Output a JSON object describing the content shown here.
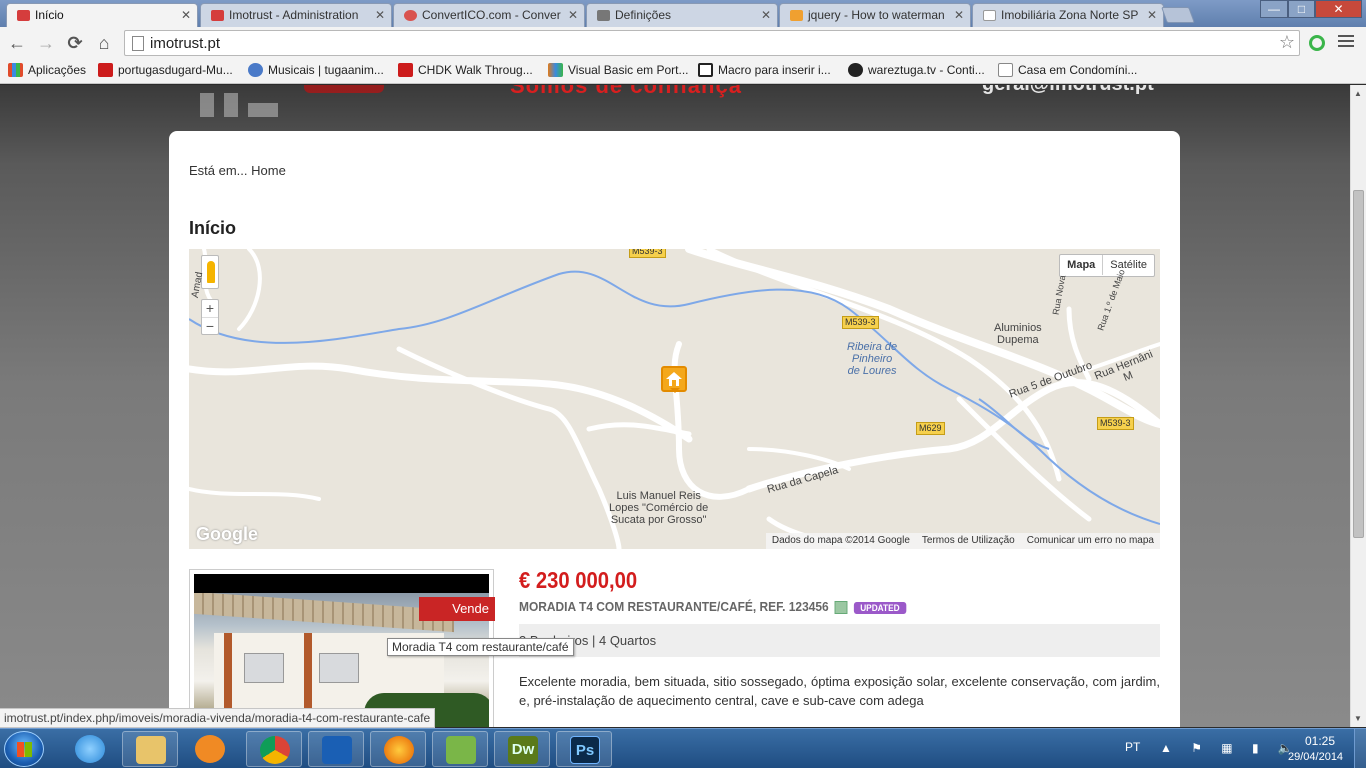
{
  "tabs": [
    {
      "label": "Início",
      "favicon_color": "#d53d3d",
      "active": true
    },
    {
      "label": "Imotrust - Administration",
      "favicon_color": "#d53d3d",
      "active": false
    },
    {
      "label": "ConvertICO.com - Conver",
      "favicon_color": "#d9534f",
      "active": false
    },
    {
      "label": "Definições",
      "favicon_color": "#777777",
      "active": false
    },
    {
      "label": "jquery - How to waterman",
      "favicon_color": "#f0a030",
      "active": false
    },
    {
      "label": "Imobiliária Zona Norte SP",
      "favicon_color": "#ffffff",
      "active": false
    }
  ],
  "window_controls": {
    "minimize": "—",
    "maximize": "□",
    "close": "✕"
  },
  "nav": {
    "back": "←",
    "forward": "→",
    "reload": "C",
    "home": "⌂"
  },
  "address": {
    "url": "imotrust.pt"
  },
  "bookmarks": [
    {
      "label": "Aplicações",
      "icon_color": "#e04b2b"
    },
    {
      "label": "portugasdugard-Mu...",
      "icon_color": "#cc1b1b"
    },
    {
      "label": "Musicais | tugaanim...",
      "icon_color": "#4a7ac8"
    },
    {
      "label": "CHDK Walk Throug...",
      "icon_color": "#cc1b1b"
    },
    {
      "label": "Visual Basic em Port...",
      "icon_color": "#e07b1b"
    },
    {
      "label": "Macro para inserir i...",
      "icon_color": "#222222"
    },
    {
      "label": "wareztuga.tv - Conti...",
      "icon_color": "#222222"
    },
    {
      "label": "Casa em Condomíni...",
      "icon_color": "#ffffff"
    }
  ],
  "site_header": {
    "slogan": "Somos de confiança",
    "email": "geral@imotrust.pt"
  },
  "breadcrumb": {
    "prefix": "Está em...",
    "current": "Home"
  },
  "page_title": "Início",
  "map": {
    "type_buttons": [
      "Mapa",
      "Satélite"
    ],
    "zoom_in": "+",
    "zoom_out": "−",
    "labels": {
      "ribeira": "Ribeira de\nPinheiro\nde Loures",
      "aluminios": "Aluminios\nDupema",
      "rua5": "Rua 5 de Outubro",
      "capela": "Rua da Capela",
      "hernani": "Rua Hernâni M",
      "luis": "Luis Manuel Reis\nLopes \"Comércio de\nSucata por Grosso\"",
      "nova": "Rua Nova",
      "maio": "Rua 1.º de Maio",
      "amad": "Amad"
    },
    "roads": [
      "M539-3",
      "M539-3",
      "M629"
    ],
    "google": "Google",
    "footer": [
      "Dados do mapa ©2014 Google",
      "Termos de Utilização",
      "Comunicar um erro no mapa"
    ]
  },
  "listing": {
    "tag": "Vende",
    "price": "€ 230 000,00",
    "title": "MORADIA T4 COM RESTAURANTE/CAFÉ, REF. 123456",
    "badge": "UPDATED",
    "specs": "3 Banheiros  |  4 Quartos",
    "tooltip": "Moradia T4 com restaurante/café",
    "description": "Excelente moradia, bem situada, sitio sossegado, óptima exposição solar, excelente conservação, com jardim, e, pré-instalação de aquecimento central, cave e sub-cave com adega"
  },
  "status_url": "imotrust.pt/index.php/imoveis/moradia-vivenda/moradia-t4-com-restaurante-cafe",
  "taskbar": {
    "apps": [
      {
        "name": "internet-explorer",
        "color": "#2a88d8"
      },
      {
        "name": "file-explorer",
        "color": "#e8c46a"
      },
      {
        "name": "media-player",
        "color": "#f08a24"
      },
      {
        "name": "chrome",
        "color": "#3aa757"
      },
      {
        "name": "outlook",
        "color": "#1a5fb4"
      },
      {
        "name": "firefox",
        "color": "#e66000"
      },
      {
        "name": "corel",
        "color": "#7ab648"
      },
      {
        "name": "dreamweaver",
        "color": "#5a7a1a",
        "label": "Dw"
      },
      {
        "name": "photoshop",
        "color": "#0b2a4a",
        "label": "Ps"
      }
    ],
    "lang": "PT",
    "time": "01:25",
    "date": "29/04/2014"
  }
}
